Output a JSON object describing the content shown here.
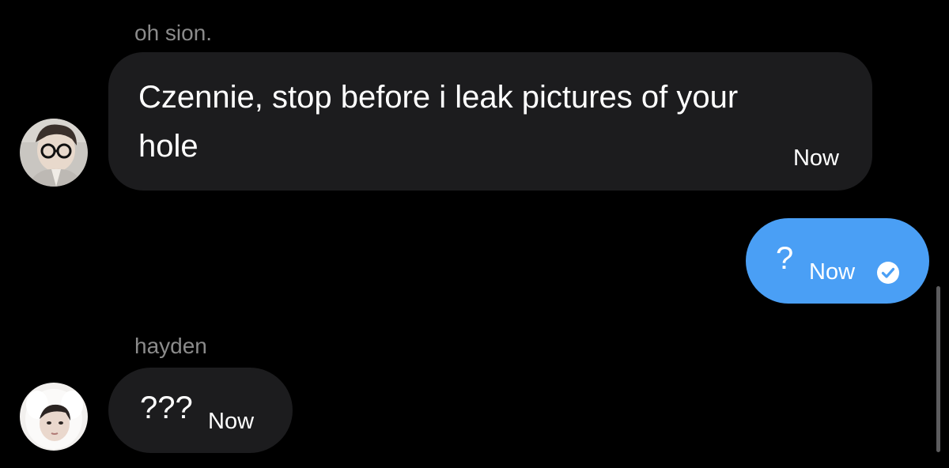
{
  "messages": [
    {
      "sender": "oh sion.",
      "avatar": "avatar-person-with-glasses",
      "text_line1": "Czennie, stop before i leak pictures of your",
      "text_line2": "hole",
      "time": "Now"
    },
    {
      "text": "?",
      "time": "Now",
      "status_icon": "check-circle-icon"
    },
    {
      "sender": "hayden",
      "avatar": "avatar-person-in-white-hood",
      "text": "???",
      "time": "Now"
    }
  ],
  "colors": {
    "background": "#000000",
    "incoming_bubble": "#1c1c1e",
    "outgoing_bubble": "#4a9ff5",
    "sender_name": "#8b8b8b"
  }
}
